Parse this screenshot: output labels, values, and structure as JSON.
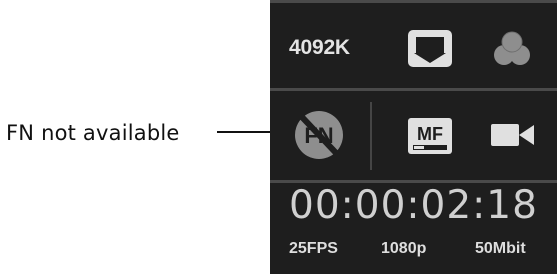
{
  "callout": {
    "label": "FN not available"
  },
  "panel": {
    "white_balance": "4092K",
    "fn_icon_text": "FN",
    "focus_mode": "MF",
    "timecode": "00:00:02:18",
    "frame_rate": "25FPS",
    "resolution": "1080p",
    "bitrate": "50Mbit"
  },
  "icons": {
    "wb_preset": "white-balance-preset-icon",
    "color": "color-circles-icon",
    "fn": "fn-disabled-icon",
    "focus": "manual-focus-icon",
    "video": "video-camera-icon"
  },
  "colors": {
    "panel_background": "#1e1e1e",
    "separator": "#4a4a4a",
    "icon_light": "#e0e0e0",
    "icon_dim": "#8e8e8e"
  }
}
